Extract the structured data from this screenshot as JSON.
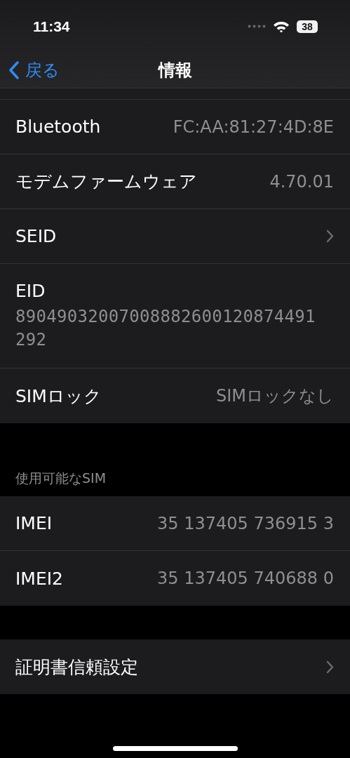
{
  "status_bar": {
    "time": "11:34",
    "battery": "38"
  },
  "nav": {
    "back": "戻る",
    "title": "情報"
  },
  "groups": [
    {
      "rows": [
        {
          "kind": "value",
          "label": "Bluetooth",
          "value": "FC:AA:81:27:4D:8E"
        },
        {
          "kind": "value",
          "label": "モデムファームウェア",
          "value": "4.70.01"
        },
        {
          "kind": "chevron",
          "label": "SEID"
        },
        {
          "kind": "stacked",
          "label": "EID",
          "value": "89049032007008882600120874491292"
        },
        {
          "kind": "value",
          "label": "SIMロック",
          "value": "SIMロックなし"
        }
      ]
    },
    {
      "header": "使用可能なSIM",
      "rows": [
        {
          "kind": "value",
          "label": "IMEI",
          "value": "35 137405 736915 3"
        },
        {
          "kind": "value",
          "label": "IMEI2",
          "value": "35 137405 740688 0"
        }
      ]
    },
    {
      "rows": [
        {
          "kind": "chevron",
          "label": "証明書信頼設定"
        }
      ]
    }
  ]
}
